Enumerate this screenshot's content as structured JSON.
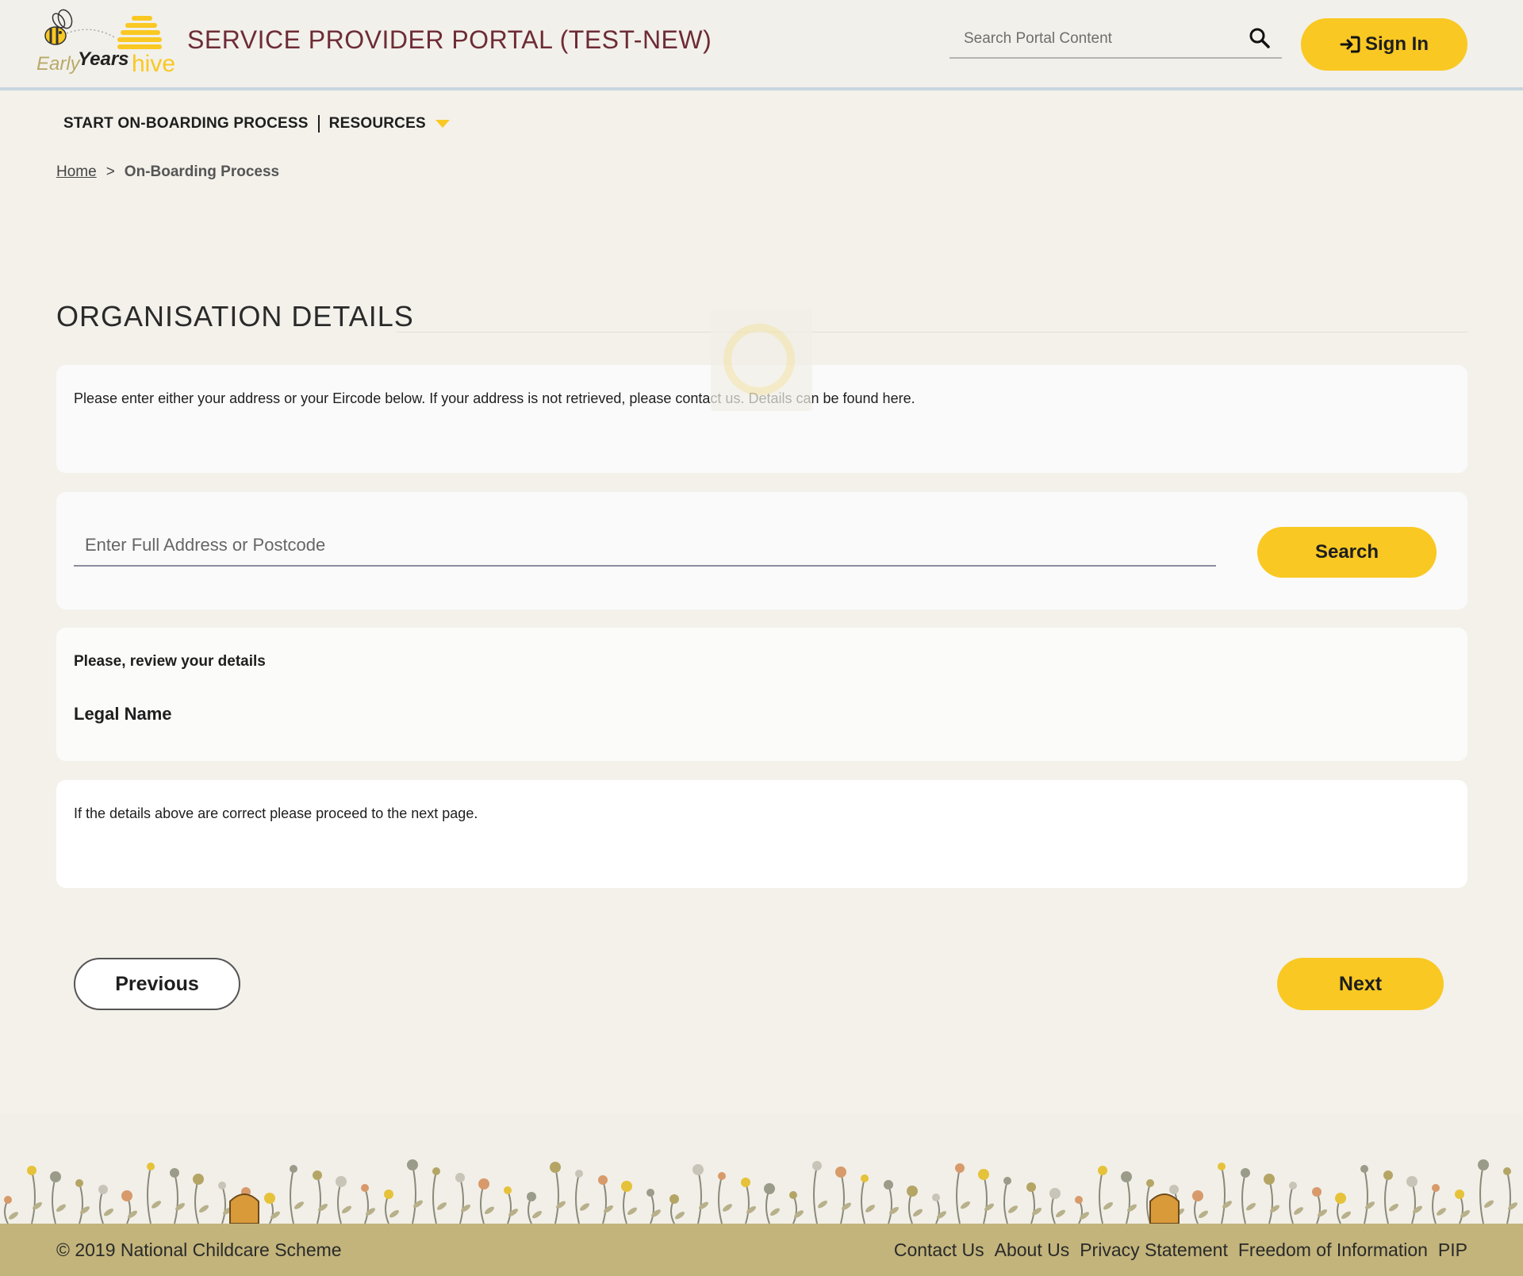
{
  "header": {
    "logo_text_early": "Early",
    "logo_text_years": "Years",
    "logo_text_hive": "hive",
    "portal_title": "SERVICE PROVIDER PORTAL (TEST-NEW)",
    "search_placeholder": "Search Portal Content",
    "signin_label": "Sign In"
  },
  "nav": {
    "items": [
      {
        "label": "START ON-BOARDING PROCESS"
      },
      {
        "label": "RESOURCES"
      }
    ]
  },
  "breadcrumb": {
    "home": "Home",
    "separator": ">",
    "current": "On-Boarding Process"
  },
  "main": {
    "section_title": "ORGANISATION DETAILS",
    "intro_text": "Please enter either your address or your Eircode below. If your address is not retrieved, please contact us. Details can be found here.",
    "address_placeholder": "Enter Full Address or Postcode",
    "search_button": "Search",
    "review_title": "Please, review your details",
    "legal_name_label": "Legal Name",
    "confirm_text": "If the details above are correct please proceed to the next page.",
    "previous_button": "Previous",
    "next_button": "Next"
  },
  "footer": {
    "copyright": "© 2019 National Childcare Scheme",
    "links": [
      "Contact Us",
      "About Us",
      "Privacy Statement",
      "Freedom of Information",
      "PIP"
    ]
  },
  "colors": {
    "accent_yellow": "#f9c823",
    "title_maroon": "#6d2c36",
    "footer_band": "#c2b47b",
    "background": "#f3f1ea"
  },
  "icons": [
    "bee-logo-icon",
    "search-icon",
    "sign-in-icon",
    "dropdown-caret-icon",
    "loading-spinner-icon"
  ]
}
